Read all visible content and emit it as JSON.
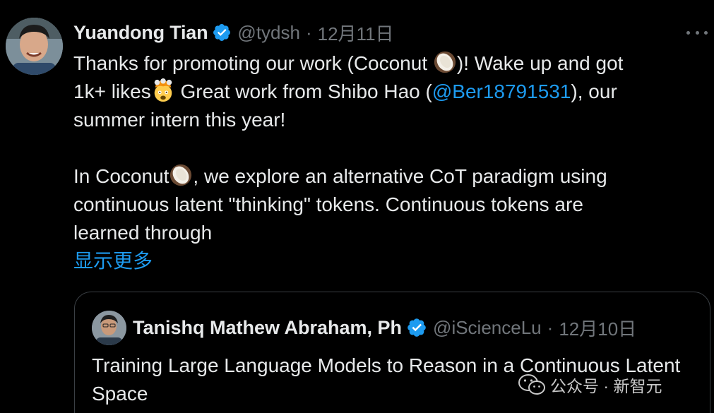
{
  "tweet": {
    "author": {
      "display_name": "Yuandong Tian",
      "handle": "@tydsh",
      "verified": true
    },
    "separator": "·",
    "timestamp": "12月11日",
    "more_icon": "more-horizontal-icon",
    "text": {
      "line1_a": "Thanks for promoting our work (Coconut ",
      "line1_b": ")! Wake up and got",
      "line2_a": "1k+ likes",
      "line2_b": " Great work from Shibo Hao (",
      "mention": "@Ber18791531",
      "line2_c": "), our",
      "line3": "summer intern this year!",
      "para2_a": "In Coconut",
      "para2_b": ", we explore an alternative CoT paradigm using",
      "para2_line2": "continuous latent \"thinking\" tokens. Continuous tokens are",
      "para2_line3": "learned through"
    },
    "show_more": "显示更多",
    "emojis": [
      "coconut-emoji",
      "exploding-head-emoji",
      "coconut-emoji"
    ]
  },
  "quote": {
    "author": {
      "display_name": "Tanishq Mathew Abraham, Ph",
      "handle": "@iScienceLu",
      "verified": true
    },
    "separator": "·",
    "timestamp": "12月10日",
    "text": "Training Large Language Models to Reason in a Continuous Latent Space"
  },
  "watermark": {
    "text": "公众号 · 新智元",
    "icon": "wechat-icon"
  },
  "colors": {
    "background": "#000000",
    "text": "#e7e9ea",
    "muted": "#71767b",
    "link": "#1d9bf0",
    "verified": "#1d9bf0",
    "border": "#3a3f44"
  }
}
